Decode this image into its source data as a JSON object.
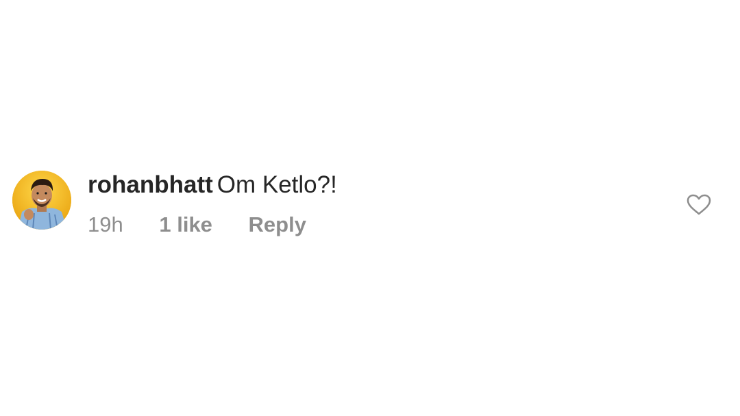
{
  "comment": {
    "username": "rohanbhatt",
    "text": "Om Ketlo?!",
    "time": "19h",
    "likes": "1 like",
    "reply_label": "Reply",
    "like_icon": "heart-outline-icon"
  },
  "colors": {
    "text_primary": "#262626",
    "text_secondary": "#8e8e8e",
    "avatar_background": "#f2b21a"
  }
}
